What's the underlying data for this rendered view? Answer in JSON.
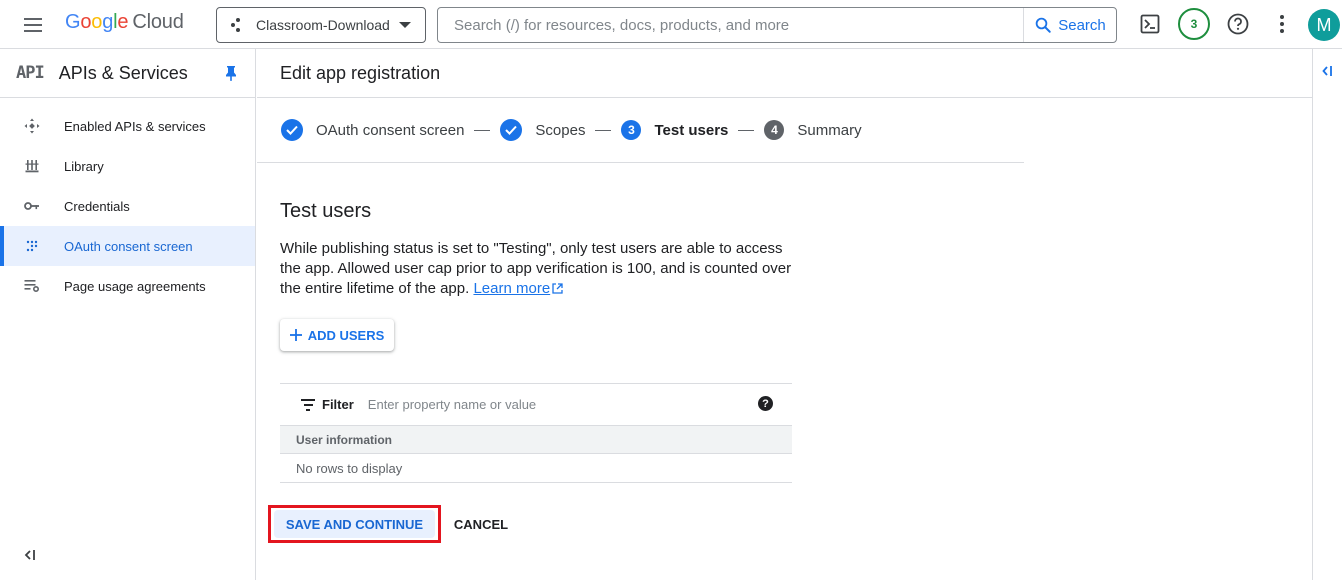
{
  "topbar": {
    "logo_google": [
      "G",
      "o",
      "o",
      "g",
      "l",
      "e"
    ],
    "logo_cloud": "Cloud",
    "project_name": "Classroom-Download",
    "search_placeholder": "Search (/) for resources, docs, products, and more",
    "search_button": "Search",
    "notification_count": "3",
    "avatar_initial": "M"
  },
  "sidebar": {
    "api_logo": "API",
    "title": "APIs & Services",
    "items": [
      {
        "label": "Enabled APIs & services",
        "icon": "enabled-apis-icon",
        "active": false
      },
      {
        "label": "Library",
        "icon": "library-icon",
        "active": false
      },
      {
        "label": "Credentials",
        "icon": "key-icon",
        "active": false
      },
      {
        "label": "OAuth consent screen",
        "icon": "oauth-icon",
        "active": true
      },
      {
        "label": "Page usage agreements",
        "icon": "agreements-icon",
        "active": false
      }
    ]
  },
  "main": {
    "page_title": "Edit app registration",
    "steps": [
      {
        "label": "OAuth consent screen",
        "state": "done"
      },
      {
        "label": "Scopes",
        "state": "done"
      },
      {
        "number": "3",
        "label": "Test users",
        "state": "current"
      },
      {
        "number": "4",
        "label": "Summary",
        "state": "todo"
      }
    ],
    "section_title": "Test users",
    "description": "While publishing status is set to \"Testing\", only test users are able to access the app. Allowed user cap prior to app verification is 100, and is counted over the entire lifetime of the app.",
    "learn_more": "Learn more",
    "add_users_label": "ADD USERS",
    "filter": {
      "label": "Filter",
      "placeholder": "Enter property name or value"
    },
    "table": {
      "column_header": "User information",
      "empty_message": "No rows to display"
    },
    "save_button": "SAVE AND CONTINUE",
    "cancel_button": "CANCEL"
  },
  "colors": {
    "accent": "#1a73e8",
    "highlight_border": "#e3151f",
    "badge_green": "#1e8e3e",
    "avatar_bg": "#0f9d9b"
  }
}
